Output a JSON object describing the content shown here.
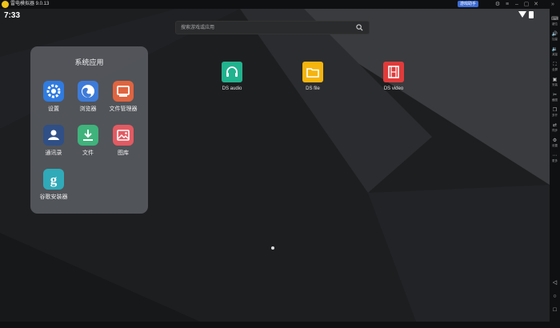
{
  "titlebar": {
    "app_title": "雷电模拟器 9.0.13",
    "badge": "游戏助手"
  },
  "status": {
    "time": "7:33"
  },
  "search": {
    "placeholder": "搜索游戏或应用"
  },
  "folder": {
    "title": "系统应用",
    "apps": [
      {
        "label": "设置",
        "icon": "gear-icon",
        "color": "#2f7be0"
      },
      {
        "label": "浏览器",
        "icon": "globe-icon",
        "color": "#3d7bd9"
      },
      {
        "label": "文件管理器",
        "icon": "file-manager-icon",
        "color": "#e06440"
      },
      {
        "label": "通讯录",
        "icon": "contacts-icon",
        "color": "#2f4f86"
      },
      {
        "label": "文件",
        "icon": "download-icon",
        "color": "#3fb37b"
      },
      {
        "label": "图库",
        "icon": "gallery-icon",
        "color": "#e25a62"
      },
      {
        "label": "谷歌安装器",
        "icon": "google-installer-icon",
        "color": "#30aab8"
      }
    ]
  },
  "desktop": {
    "apps": [
      {
        "label": "DS audio",
        "icon": "headphones-icon",
        "color": "#21b28e"
      },
      {
        "label": "DS file",
        "icon": "folder-icon",
        "color": "#f5b40e"
      },
      {
        "label": "DS video",
        "icon": "film-icon",
        "color": "#e03b3b"
      }
    ]
  },
  "sidebar": {
    "items": [
      {
        "label": "键位",
        "icon": "keyboard-icon"
      },
      {
        "label": "加量",
        "icon": "volume-up-icon"
      },
      {
        "label": "减量",
        "icon": "volume-down-icon"
      },
      {
        "label": "全屏",
        "icon": "fullscreen-icon"
      },
      {
        "label": "安装",
        "icon": "apk-install-icon"
      },
      {
        "label": "截图",
        "icon": "screenshot-icon"
      },
      {
        "label": "多开",
        "icon": "multi-instance-icon"
      },
      {
        "label": "同步",
        "icon": "sync-icon"
      },
      {
        "label": "设置",
        "icon": "settings-icon"
      },
      {
        "label": "更多",
        "icon": "more-icon"
      }
    ]
  }
}
